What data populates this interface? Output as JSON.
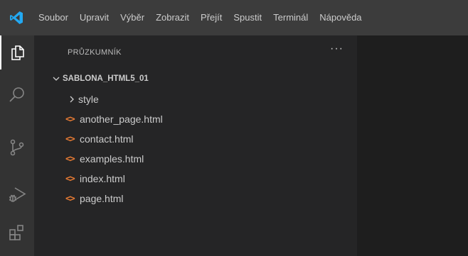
{
  "menubar": {
    "logo_icon": "vscode-logo-icon",
    "items": [
      "Soubor",
      "Upravit",
      "Výběr",
      "Zobrazit",
      "Přejít",
      "Spustit",
      "Terminál",
      "Nápověda"
    ]
  },
  "activitybar": {
    "icons": [
      "explorer-icon",
      "search-icon",
      "source-control-icon",
      "run-debug-icon",
      "extensions-icon"
    ]
  },
  "sidebar": {
    "title": "PRŮZKUMNÍK",
    "more_actions": "···",
    "folder": "SABLONA_HTML5_01",
    "subfolders": [
      "style"
    ],
    "files": [
      "another_page.html",
      "contact.html",
      "examples.html",
      "index.html",
      "page.html"
    ]
  },
  "colors": {
    "menubar_bg": "#3c3c3c",
    "activitybar_bg": "#333333",
    "sidebar_bg": "#252526",
    "editor_bg": "#1e1e1e",
    "logo_blue": "#23a9f2",
    "html_icon": "#e37933"
  }
}
